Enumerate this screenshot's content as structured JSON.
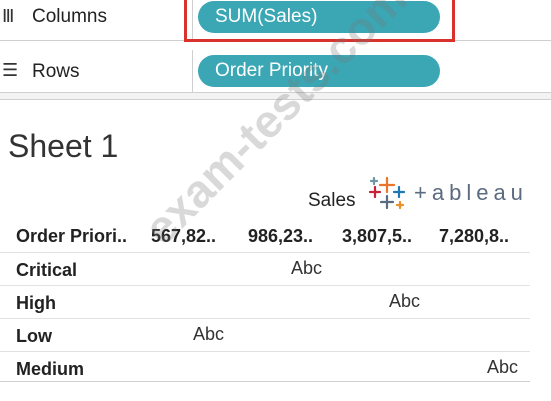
{
  "shelves": {
    "columns": {
      "icon": "columns-icon",
      "label": "Columns",
      "pill": "SUM(Sales)"
    },
    "rows": {
      "icon": "rows-icon",
      "label": "Rows",
      "pill": "Order Priority"
    }
  },
  "sheet": {
    "title": "Sheet 1"
  },
  "view": {
    "axis_title": "Sales",
    "logo_text": "+ableau",
    "row_header": "Order Priori..",
    "column_headers": [
      "567,82..",
      "986,23..",
      "3,807,5..",
      "7,280,8.."
    ],
    "rows": [
      {
        "label": "Critical",
        "mark": "Abc"
      },
      {
        "label": "High",
        "mark": "Abc"
      },
      {
        "label": "Low",
        "mark": "Abc"
      },
      {
        "label": "Medium",
        "mark": "Abc"
      }
    ]
  },
  "watermark": "exam-tests.com",
  "colors": {
    "pill": "#3ba7b5",
    "highlight": "#d9322d"
  }
}
